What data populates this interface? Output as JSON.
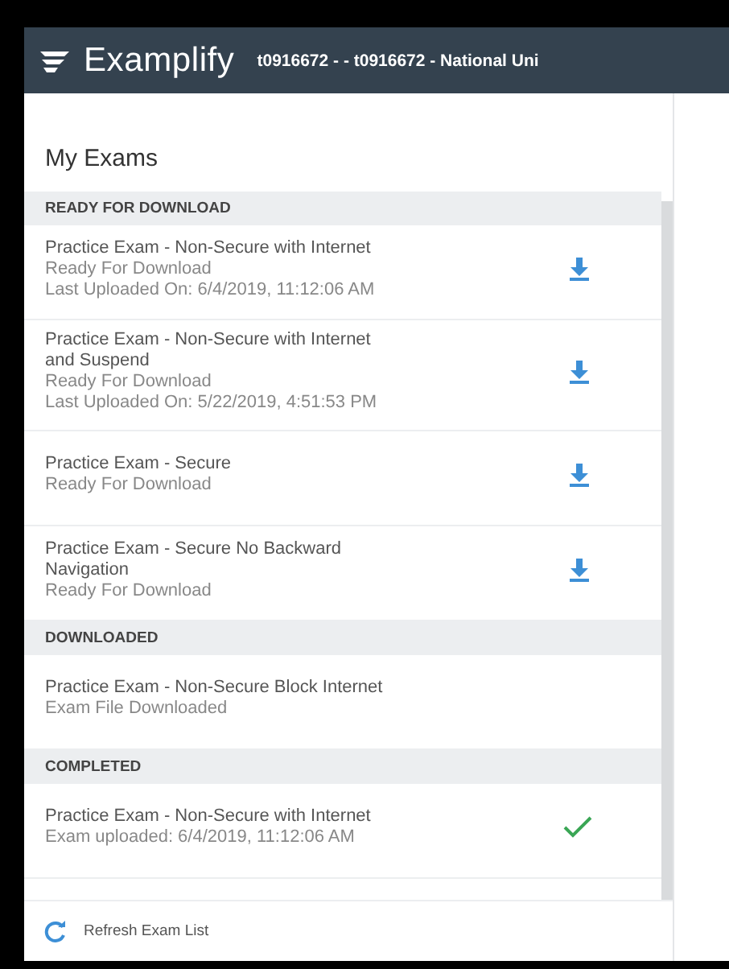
{
  "app": {
    "title": "Examplify",
    "account": "t0916672 - - t0916672 - National Uni"
  },
  "page_title": "My Exams",
  "sections": [
    {
      "heading": "READY FOR DOWNLOAD",
      "exams": [
        {
          "name": "Practice Exam - Non-Secure with Internet",
          "lines": [
            "Ready For Download",
            "Last Uploaded On: 6/4/2019, 11:12:06 AM"
          ],
          "kind": "download"
        },
        {
          "name": "Practice Exam - Non-Secure with Internet and Suspend",
          "lines": [
            "Ready For Download",
            "Last Uploaded On: 5/22/2019, 4:51:53 PM"
          ],
          "kind": "download"
        },
        {
          "name": "Practice Exam - Secure",
          "lines": [
            "Ready For Download"
          ],
          "kind": "download"
        },
        {
          "name": "Practice Exam - Secure No Backward Navigation",
          "lines": [
            "Ready For Download"
          ],
          "kind": "download"
        }
      ]
    },
    {
      "heading": "DOWNLOADED",
      "exams": [
        {
          "name": "Practice Exam - Non-Secure Block Internet",
          "lines": [
            "Exam File Downloaded"
          ],
          "kind": "downloaded"
        }
      ]
    },
    {
      "heading": "COMPLETED",
      "exams": [
        {
          "name": "Practice Exam - Non-Secure with Internet",
          "lines": [
            "Exam uploaded: 6/4/2019, 11:12:06 AM"
          ],
          "kind": "completed"
        }
      ]
    }
  ],
  "footer": {
    "refresh_label": "Refresh Exam List"
  }
}
